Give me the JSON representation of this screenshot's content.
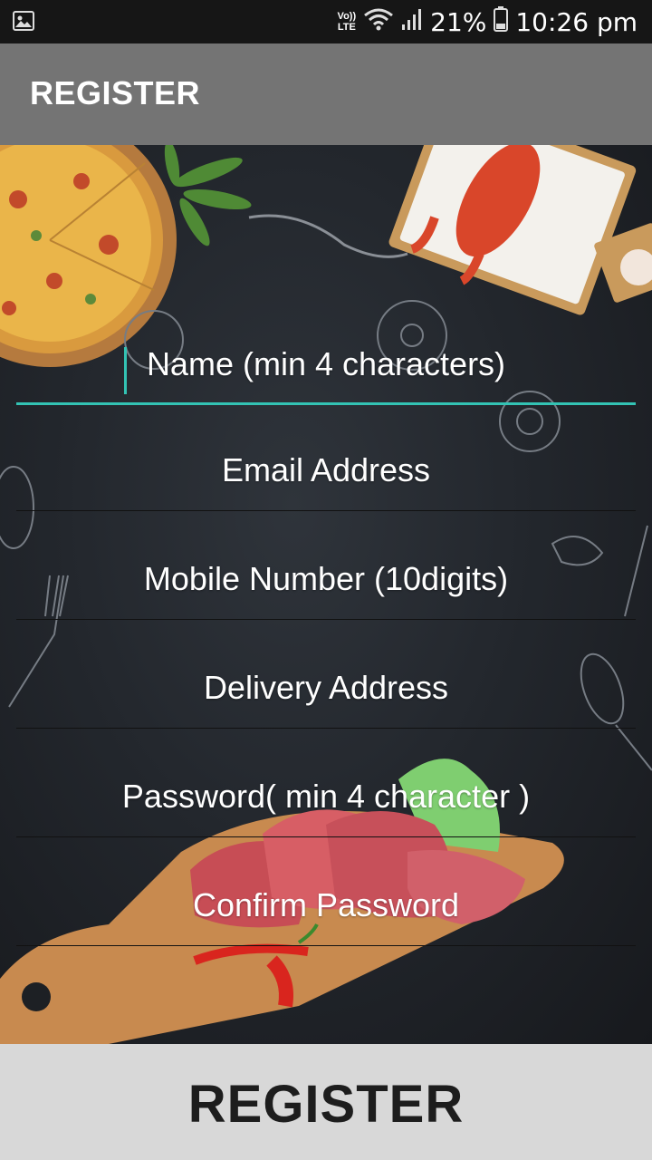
{
  "status_bar": {
    "volte_top": "Vo))",
    "volte_bottom": "LTE",
    "battery": "21%",
    "time": "10:26 pm",
    "icons": [
      "gallery-icon",
      "wifi-icon",
      "signal-icon",
      "battery-icon"
    ]
  },
  "app_bar": {
    "title": "REGISTER"
  },
  "form": {
    "fields": [
      {
        "placeholder": "Name (min 4 characters)",
        "active": true
      },
      {
        "placeholder": "Email Address"
      },
      {
        "placeholder": "Mobile Number (10digits)"
      },
      {
        "placeholder": "Delivery Address"
      },
      {
        "placeholder": "Password( min 4 character )"
      },
      {
        "placeholder": "Confirm Password"
      }
    ]
  },
  "register_button": {
    "label": "REGISTER"
  },
  "colors": {
    "accent": "#33c3b4",
    "app_bar": "#747474",
    "button_bg": "#d8d8d8"
  }
}
